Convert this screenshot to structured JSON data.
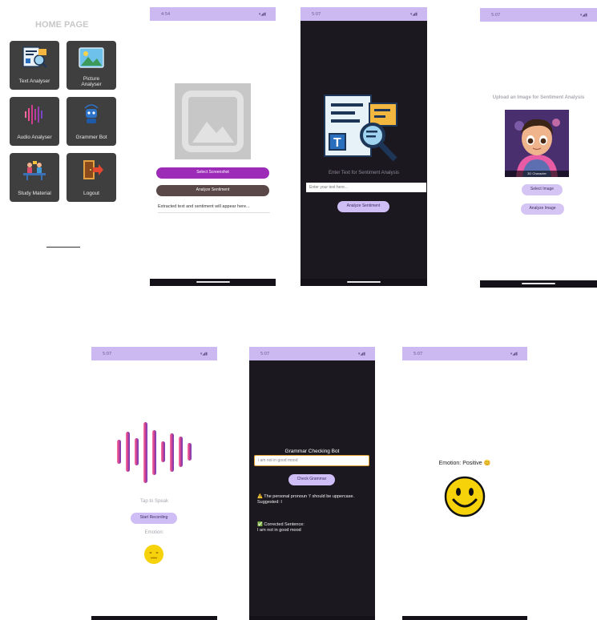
{
  "home": {
    "title": "HOME PAGE",
    "tiles": [
      {
        "label": "Text Analyser",
        "icon": "text-analysis-icon"
      },
      {
        "label": "Picture Analyser",
        "icon": "picture-icon"
      },
      {
        "label": "Audio Analyser",
        "icon": "audio-wave-icon"
      },
      {
        "label": "Grammer Bot",
        "icon": "robot-icon"
      },
      {
        "label": "Study Material",
        "icon": "study-icon"
      },
      {
        "label": "Logout",
        "icon": "logout-icon"
      }
    ]
  },
  "screenshot_screen": {
    "status_time": "4:54",
    "select_button": "Select Screenshot",
    "analyze_button": "Analyze Sentiment",
    "result_text": "Extracted text and sentiment will appear here..."
  },
  "text_screen": {
    "status_time": "5:07",
    "prompt": "Enter Text for Sentiment Analysis",
    "input_placeholder": "Enter your text here...",
    "analyze_button": "Analyze Sentiment"
  },
  "image_screen": {
    "status_time": "5:07",
    "heading": "Upload an Image for Sentiment Analysis",
    "preview_caption": "3D Character",
    "select_button": "Select Image",
    "analyze_button": "Analyze Image"
  },
  "audio_screen": {
    "status_time": "5:07",
    "tap_text": "Tap to Speak",
    "record_button": "Start Recording",
    "emotion_label": "Emotion:"
  },
  "grammar_screen": {
    "status_time": "5:07",
    "title": "Grammar Checking Bot",
    "input_value": "i am not in good mood",
    "check_button": "Check Grammar",
    "warning_text": "⚠️ The personal pronoun 'i' should be uppercase. Suggested: I",
    "corrected_label": "✅ Corrected Sentence:",
    "corrected_text": "I am not in good mood"
  },
  "emotion_screen": {
    "status_time": "5:07",
    "emotion_text": "Emotion: Positive 😊"
  },
  "colors": {
    "status_bar": "#cdb9f2",
    "purple_button": "#9c2bb8",
    "brown_button": "#5a4848",
    "lavender_button": "#cfbdf6",
    "dark_bg": "#1c1820",
    "emoji_yellow": "#f5d20a"
  }
}
